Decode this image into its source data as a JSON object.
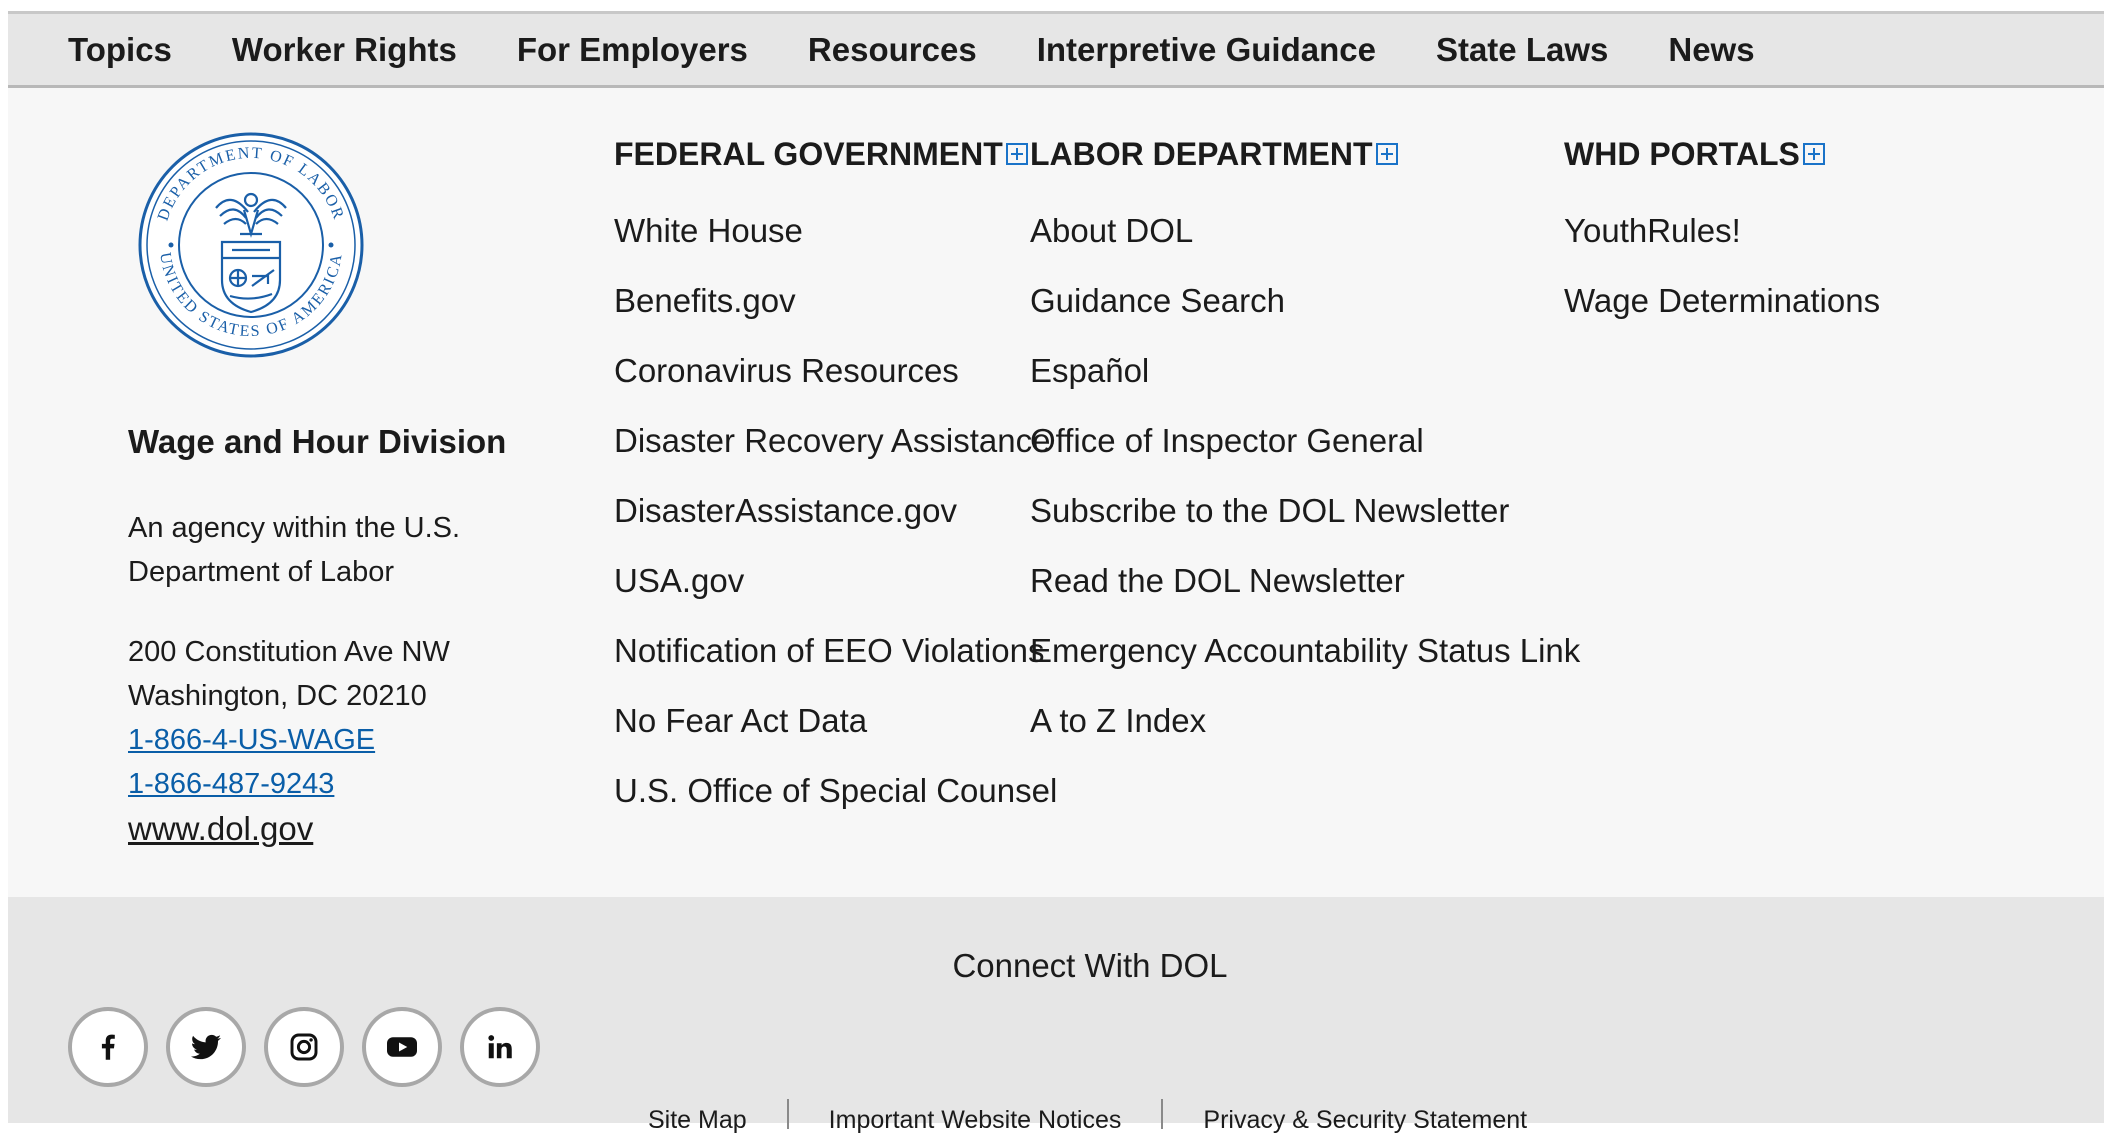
{
  "topnav": {
    "items": [
      "Topics",
      "Worker Rights",
      "For Employers",
      "Resources",
      "Interpretive Guidance",
      "State Laws",
      "News"
    ]
  },
  "seal": {
    "top_text": "DEPARTMENT OF LABOR",
    "bottom_text": "UNITED STATES OF AMERICA"
  },
  "agency": {
    "name": "Wage and Hour Division",
    "description": "An agency within the U.S. Department of Labor",
    "address_line1": "200 Constitution Ave NW",
    "address_line2": "Washington, DC 20210",
    "phone1": "1-866-4-US-WAGE",
    "phone2": "1-866-487-9243",
    "website": "www.dol.gov"
  },
  "columns": [
    {
      "heading": "FEDERAL GOVERNMENT",
      "links": [
        "White House",
        "Benefits.gov",
        "Coronavirus Resources",
        "Disaster Recovery Assistance",
        "DisasterAssistance.gov",
        "USA.gov",
        "Notification of EEO Violations",
        "No Fear Act Data",
        "U.S. Office of Special Counsel"
      ]
    },
    {
      "heading": "LABOR DEPARTMENT",
      "links": [
        "About DOL",
        "Guidance Search",
        "Español",
        "Office of Inspector General",
        "Subscribe to the DOL Newsletter",
        "Read the DOL Newsletter",
        "Emergency Accountability Status Link",
        "A to Z Index"
      ]
    },
    {
      "heading": "WHD PORTALS",
      "links": [
        "YouthRules!",
        "Wage Determinations"
      ]
    }
  ],
  "connect": {
    "title": "Connect With DOL",
    "social": [
      "facebook-icon",
      "twitter-icon",
      "instagram-icon",
      "youtube-icon",
      "linkedin-icon"
    ]
  },
  "bottom_links": [
    "Site Map",
    "Important Website Notices",
    "Privacy & Security Statement"
  ],
  "colors": {
    "link_blue": "#0a5ea8",
    "seal_blue": "#1a5fa8",
    "plus_blue": "#1a73c8"
  }
}
